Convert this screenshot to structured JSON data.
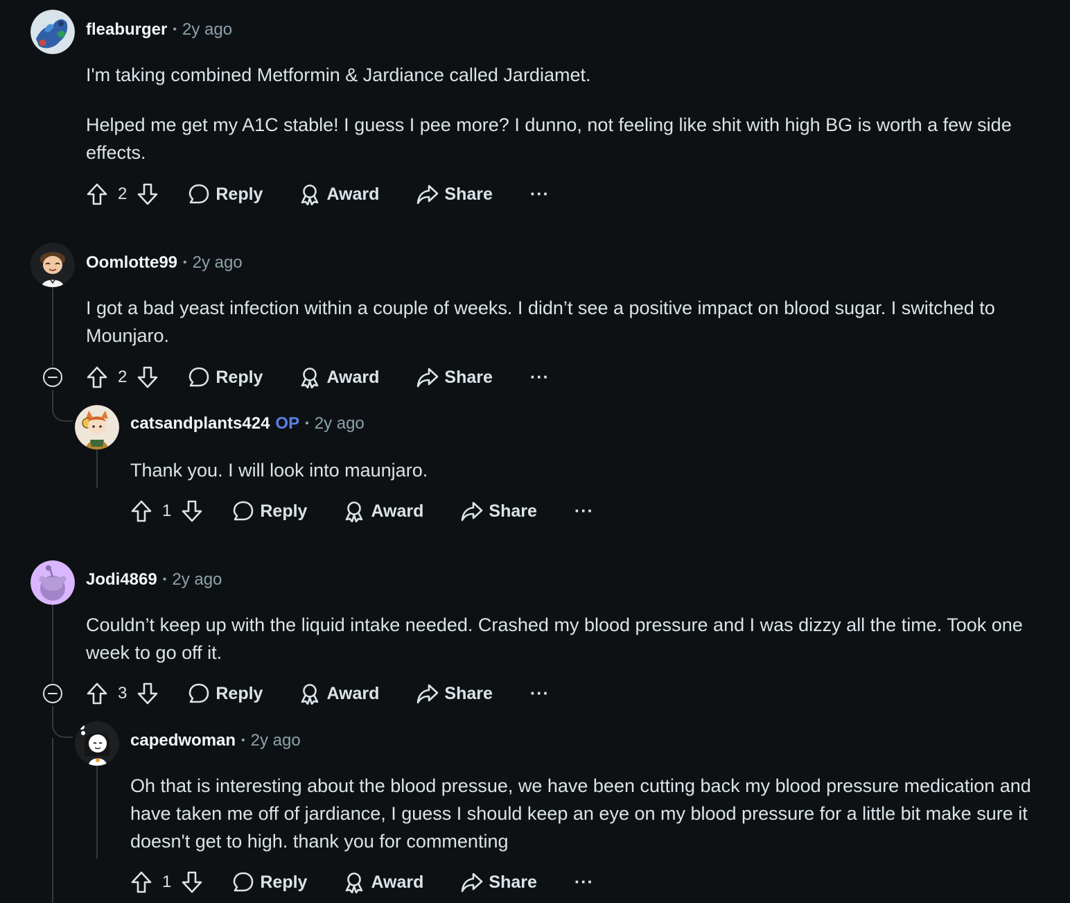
{
  "labels": {
    "reply": "Reply",
    "award": "Award",
    "share": "Share",
    "op": "OP",
    "more": "···"
  },
  "comments": [
    {
      "username": "fleaburger",
      "time": "2y ago",
      "paragraphs": [
        "I'm taking combined Metformin & Jardiance called Jardiamet.",
        "Helped me get my A1C stable! I guess I pee more? I dunno, not feeling like shit with high BG is worth a few side effects."
      ],
      "votes": "2"
    },
    {
      "username": "Oomlotte99",
      "time": "2y ago",
      "paragraphs": [
        "I got a bad yeast infection within a couple of weeks. I didn’t see a positive impact on blood sugar. I switched to Mounjaro."
      ],
      "votes": "2"
    },
    {
      "username": "catsandplants424",
      "is_op": true,
      "time": "2y ago",
      "paragraphs": [
        "Thank you. I will look into maunjaro."
      ],
      "votes": "1"
    },
    {
      "username": "Jodi4869",
      "time": "2y ago",
      "paragraphs": [
        "Couldn’t keep up with the liquid intake needed. Crashed my blood pressure and I was dizzy all the time. Took one week to go off it."
      ],
      "votes": "3"
    },
    {
      "username": "capedwoman",
      "time": "2y ago",
      "paragraphs": [
        "Oh that is interesting about the blood pressue, we have been cutting back my blood pressure medication and have taken me off of jardiance, I guess I should keep an eye on my blood pressure for a little bit make sure it doesn't get to high. thank you for commenting"
      ],
      "votes": "1"
    }
  ],
  "colors": {
    "background": "#0e1113",
    "text": "#dbe4e9",
    "meta": "#8ba2ad",
    "op": "#5b7fe6",
    "thread_line": "#33393d"
  }
}
